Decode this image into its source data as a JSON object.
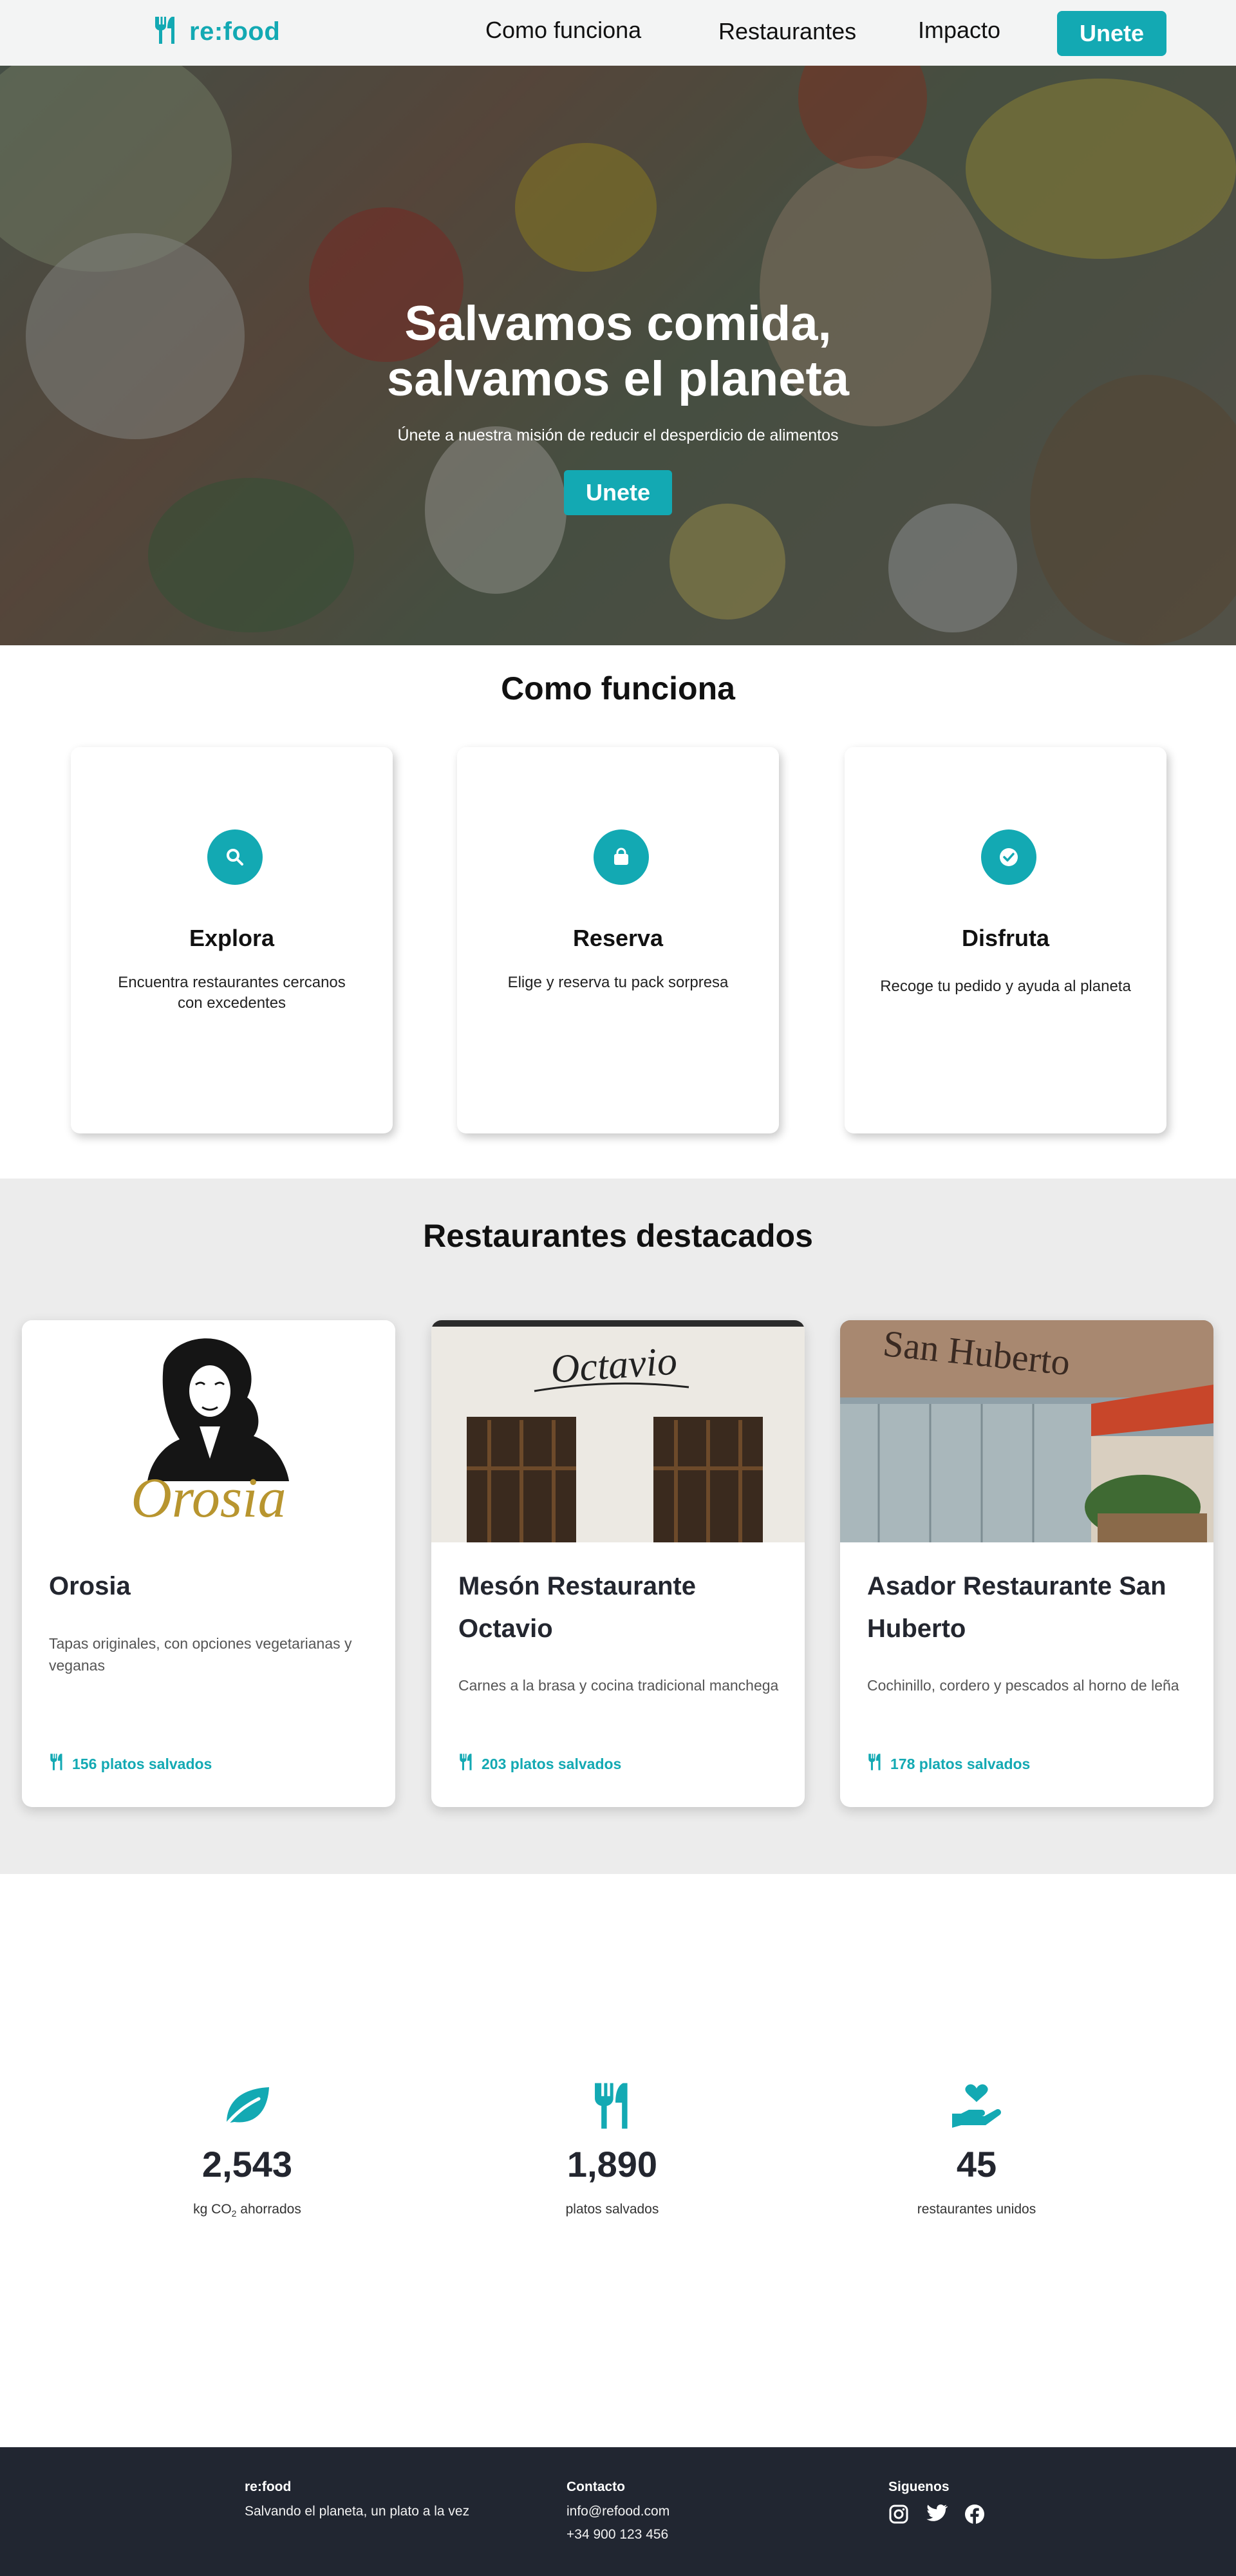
{
  "colors": {
    "accent": "#13a9b3",
    "dark": "#212631",
    "section_bg": "#ececec"
  },
  "nav": {
    "brand": "re:food",
    "links": [
      "Como funciona",
      "Restaurantes",
      "Impacto"
    ],
    "cta": "Unete"
  },
  "hero": {
    "title_line1": "Salvamos comida,",
    "title_line2": "salvamos el planeta",
    "subtitle": "Únete a nuestra misión de reducir el desperdicio de alimentos",
    "cta": "Unete"
  },
  "how": {
    "title": "Como funciona",
    "steps": [
      {
        "icon": "search-icon",
        "title": "Explora",
        "desc": "Encuentra restaurantes cercanos con excedentes"
      },
      {
        "icon": "shopping-bag-icon",
        "title": "Reserva",
        "desc": "Elige y reserva tu pack sorpresa"
      },
      {
        "icon": "check-circle-icon",
        "title": "Disfruta",
        "desc": "Recoge tu pedido y ayuda al planeta"
      }
    ]
  },
  "restaurants": {
    "title": "Restaurantes destacados",
    "items": [
      {
        "name": "Orosia",
        "desc": "Tapas originales, con opciones vegetarianas y veganas",
        "saved": "156 platos salvados",
        "logo_text": "Orosia"
      },
      {
        "name": "Mesón Restaurante Octavio",
        "desc": "Carnes a la brasa y cocina tradicional manchega",
        "saved": "203 platos salvados",
        "sign_text": "Octavio"
      },
      {
        "name": "Asador Restaurante San Huberto",
        "desc": "Cochinillo, cordero y pescados al horno de leña",
        "saved": "178 platos salvados",
        "sign_text": "San Huberto"
      }
    ]
  },
  "stats": [
    {
      "icon": "leaf-icon",
      "value": "2,543",
      "label_prefix": "kg CO",
      "label_sub": "2",
      "label_suffix": " ahorrados"
    },
    {
      "icon": "utensils-icon",
      "value": "1,890",
      "label": "platos salvados"
    },
    {
      "icon": "hand-heart-icon",
      "value": "45",
      "label": "restaurantes unidos"
    }
  ],
  "footer": {
    "brand": "re:food",
    "tagline": "Salvando el planeta, un plato a la vez",
    "contact_title": "Contacto",
    "email": "info@refood.com",
    "phone": "+34 900 123 456",
    "follow_title": "Siguenos",
    "social": [
      "instagram-icon",
      "twitter-icon",
      "facebook-icon"
    ]
  }
}
